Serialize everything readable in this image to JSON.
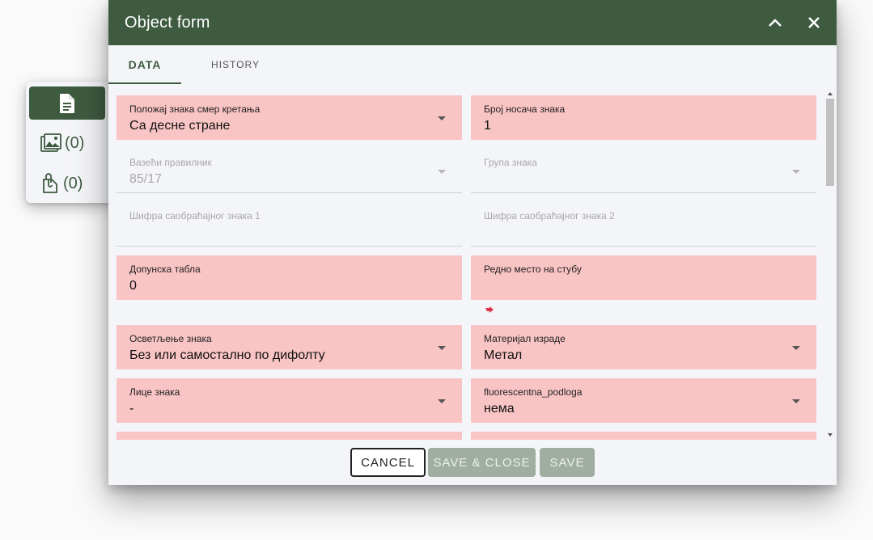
{
  "side": {
    "images_count": "(0)",
    "attachments_count": "(0)"
  },
  "dialog": {
    "title": "Object form",
    "tabs": {
      "data": "DATA",
      "history": "HISTORY"
    },
    "fields": [
      {
        "label": "Положај знака смер кретања",
        "value": "Са десне стране"
      },
      {
        "label": "Број носача знака",
        "value": "1"
      },
      {
        "label": "Вазећи правилник",
        "value": "85/17"
      },
      {
        "label": "Група знака",
        "value": ""
      },
      {
        "label": "Шифра саобраћајног знака 1",
        "value": ""
      },
      {
        "label": "Шифра саобраћајног знака 2",
        "value": ""
      },
      {
        "label": "Допунска табла",
        "value": "0"
      },
      {
        "label": "Редно место на стубу",
        "value": ""
      },
      {
        "label": "Осветљење знака",
        "value": "Без или самостално по дифолту"
      },
      {
        "label": "Материјал израде",
        "value": "Метал"
      },
      {
        "label": "Лице знака",
        "value": "-"
      },
      {
        "label": "fluorescentna_podloga",
        "value": "нема"
      }
    ],
    "buttons": {
      "cancel": "CANCEL",
      "save_close": "SAVE & CLOSE",
      "save": "SAVE"
    }
  },
  "colors": {
    "primary": "#3e5b3f",
    "error_bg": "#f9c4c4",
    "accent_red": "#e0344a"
  }
}
